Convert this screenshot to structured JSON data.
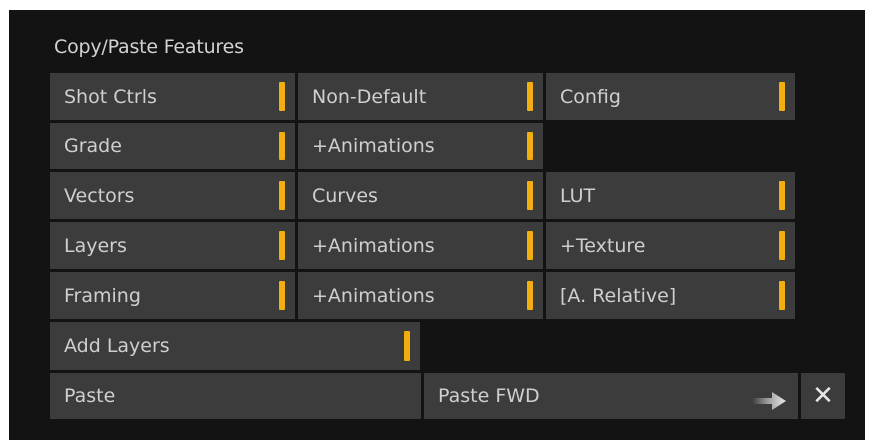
{
  "title": "Copy/Paste Features",
  "accent_color": "#f2ad0f",
  "grid": [
    [
      "Shot Ctrls",
      "Non-Default",
      "Config"
    ],
    [
      "Grade",
      "+Animations",
      ""
    ],
    [
      "Vectors",
      "Curves",
      "LUT"
    ],
    [
      "Layers",
      "+Animations",
      "+Texture"
    ],
    [
      "Framing",
      "+Animations",
      "[A. Relative]"
    ]
  ],
  "add_layers": "Add Layers",
  "paste": "Paste",
  "paste_fwd": "Paste FWD",
  "icons": {
    "paste_fwd": "arrow-right-icon",
    "close": "close-icon"
  },
  "close_symbol": "✕"
}
